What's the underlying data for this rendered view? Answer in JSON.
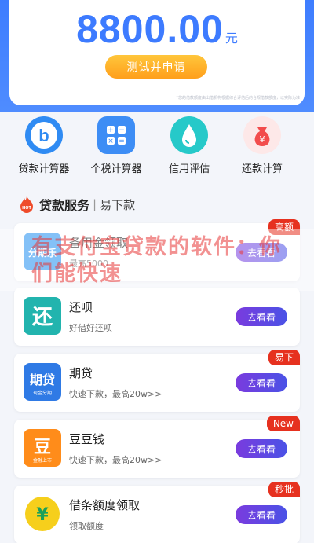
{
  "hero": {
    "amount": "8800.00",
    "unit": "元",
    "apply_label": "测试并申请",
    "disclaimer": "*您的借款额度由出借机构根据综合评估后的合规借款额度，以实际为准"
  },
  "tools": [
    {
      "label": "贷款计算器",
      "icon": "b-icon",
      "color": "#2f8bf3"
    },
    {
      "label": "个税计算器",
      "icon": "calculator-icon",
      "color": "#3d8df5"
    },
    {
      "label": "信用评估",
      "icon": "drop-icon",
      "color": "#26c9c9"
    },
    {
      "label": "还款计算",
      "icon": "money-bag-icon",
      "color": "#f24c4c"
    }
  ],
  "section": {
    "badge": "HOT",
    "title": "贷款服务",
    "separator": "|",
    "subtitle": "易下款"
  },
  "overlay_text": "有支付宝贷款的软件：你们能快速",
  "cards": [
    {
      "name": "备用金领取",
      "desc": "最高5000",
      "button": "去看看",
      "tag": "高额",
      "logo_text": "分期乐",
      "logo_color": "#1f8ef1"
    },
    {
      "name": "还呗",
      "desc": "好借好还呗",
      "button": "去看看",
      "tag": "",
      "logo_text": "还",
      "logo_color": "#22b4ae"
    },
    {
      "name": "期贷",
      "desc": "快速下款，最高20w>>",
      "button": "去看看",
      "tag": "易下",
      "logo_text": "期贷",
      "logo_sub": "现金分期",
      "logo_color": "#2f7ae5"
    },
    {
      "name": "豆豆钱",
      "desc": "快速下款，最高20w>>",
      "button": "去看看",
      "tag": "New",
      "logo_text": "豆",
      "logo_sub": "金融上市",
      "logo_color": "#ff8c1a"
    },
    {
      "name": "借条额度领取",
      "desc": "领取额度",
      "button": "去看看",
      "tag": "秒批",
      "logo_text": "¥",
      "logo_color": "#f6cf1c"
    }
  ]
}
